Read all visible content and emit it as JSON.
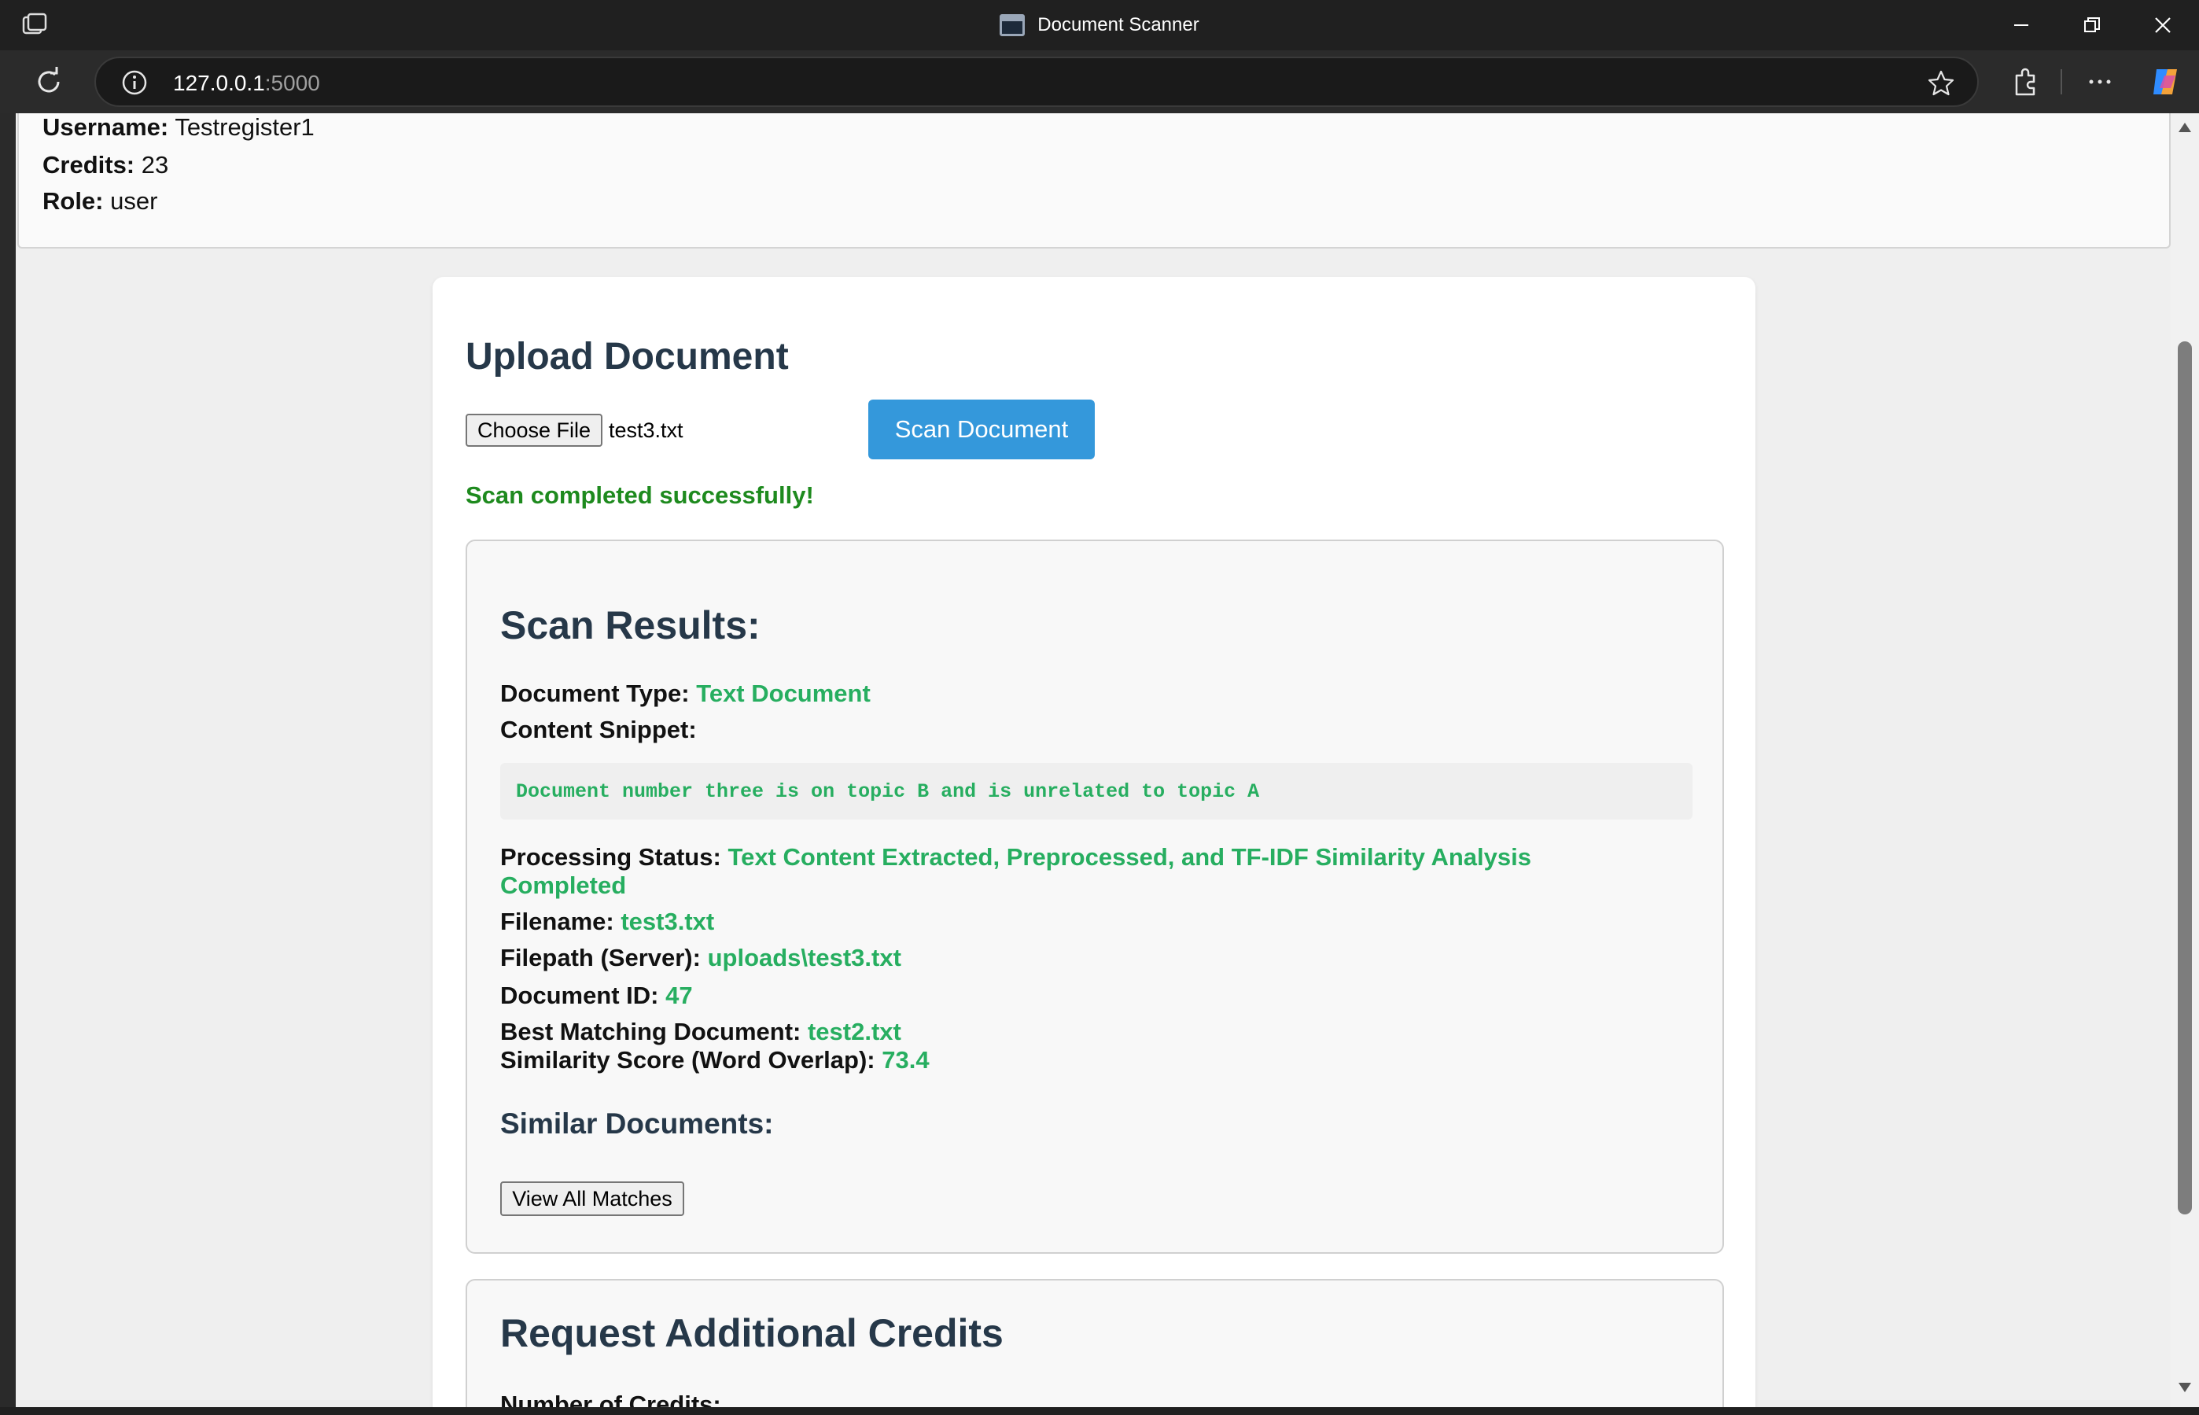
{
  "window": {
    "title": "Document Scanner",
    "min_icon": "minimize-icon",
    "max_icon": "restore-icon",
    "close_icon": "close-icon"
  },
  "browser": {
    "url_host": "127.0.0.1",
    "url_port": ":5000"
  },
  "user": {
    "username_label": "Username:",
    "username": "Testregister1",
    "credits_label": "Credits:",
    "credits": "23",
    "role_label": "Role:",
    "role": "user"
  },
  "upload": {
    "heading": "Upload Document",
    "choose_file_label": "Choose File",
    "file_name": "test3.txt",
    "scan_button": "Scan Document",
    "success_message": "Scan completed successfully!"
  },
  "results": {
    "heading": "Scan Results:",
    "doc_type_label": "Document Type:",
    "doc_type": "Text Document",
    "snippet_label": "Content Snippet:",
    "snippet": "Document number three is on topic B and is unrelated to topic A",
    "status_label": "Processing Status:",
    "status_line1": "Text Content Extracted, Preprocessed, and TF-IDF Similarity Analysis",
    "status_line2": "Completed",
    "filename_label": "Filename:",
    "filename": "test3.txt",
    "filepath_label": "Filepath (Server):",
    "filepath": "uploads\\test3.txt",
    "doc_id_label": "Document ID:",
    "doc_id": "47",
    "best_match_label": "Best Matching Document:",
    "best_match": "test2.txt",
    "similarity_label": "Similarity Score (Word Overlap):",
    "similarity": "73.4",
    "similar_heading": "Similar Documents:",
    "view_all_button": "View All Matches"
  },
  "credits_request": {
    "heading": "Request Additional Credits",
    "number_label": "Number of Credits:"
  },
  "colors": {
    "accent": "#3498db",
    "success": "#1e8a1e",
    "value_green": "#27ae60",
    "heading": "#263849"
  }
}
